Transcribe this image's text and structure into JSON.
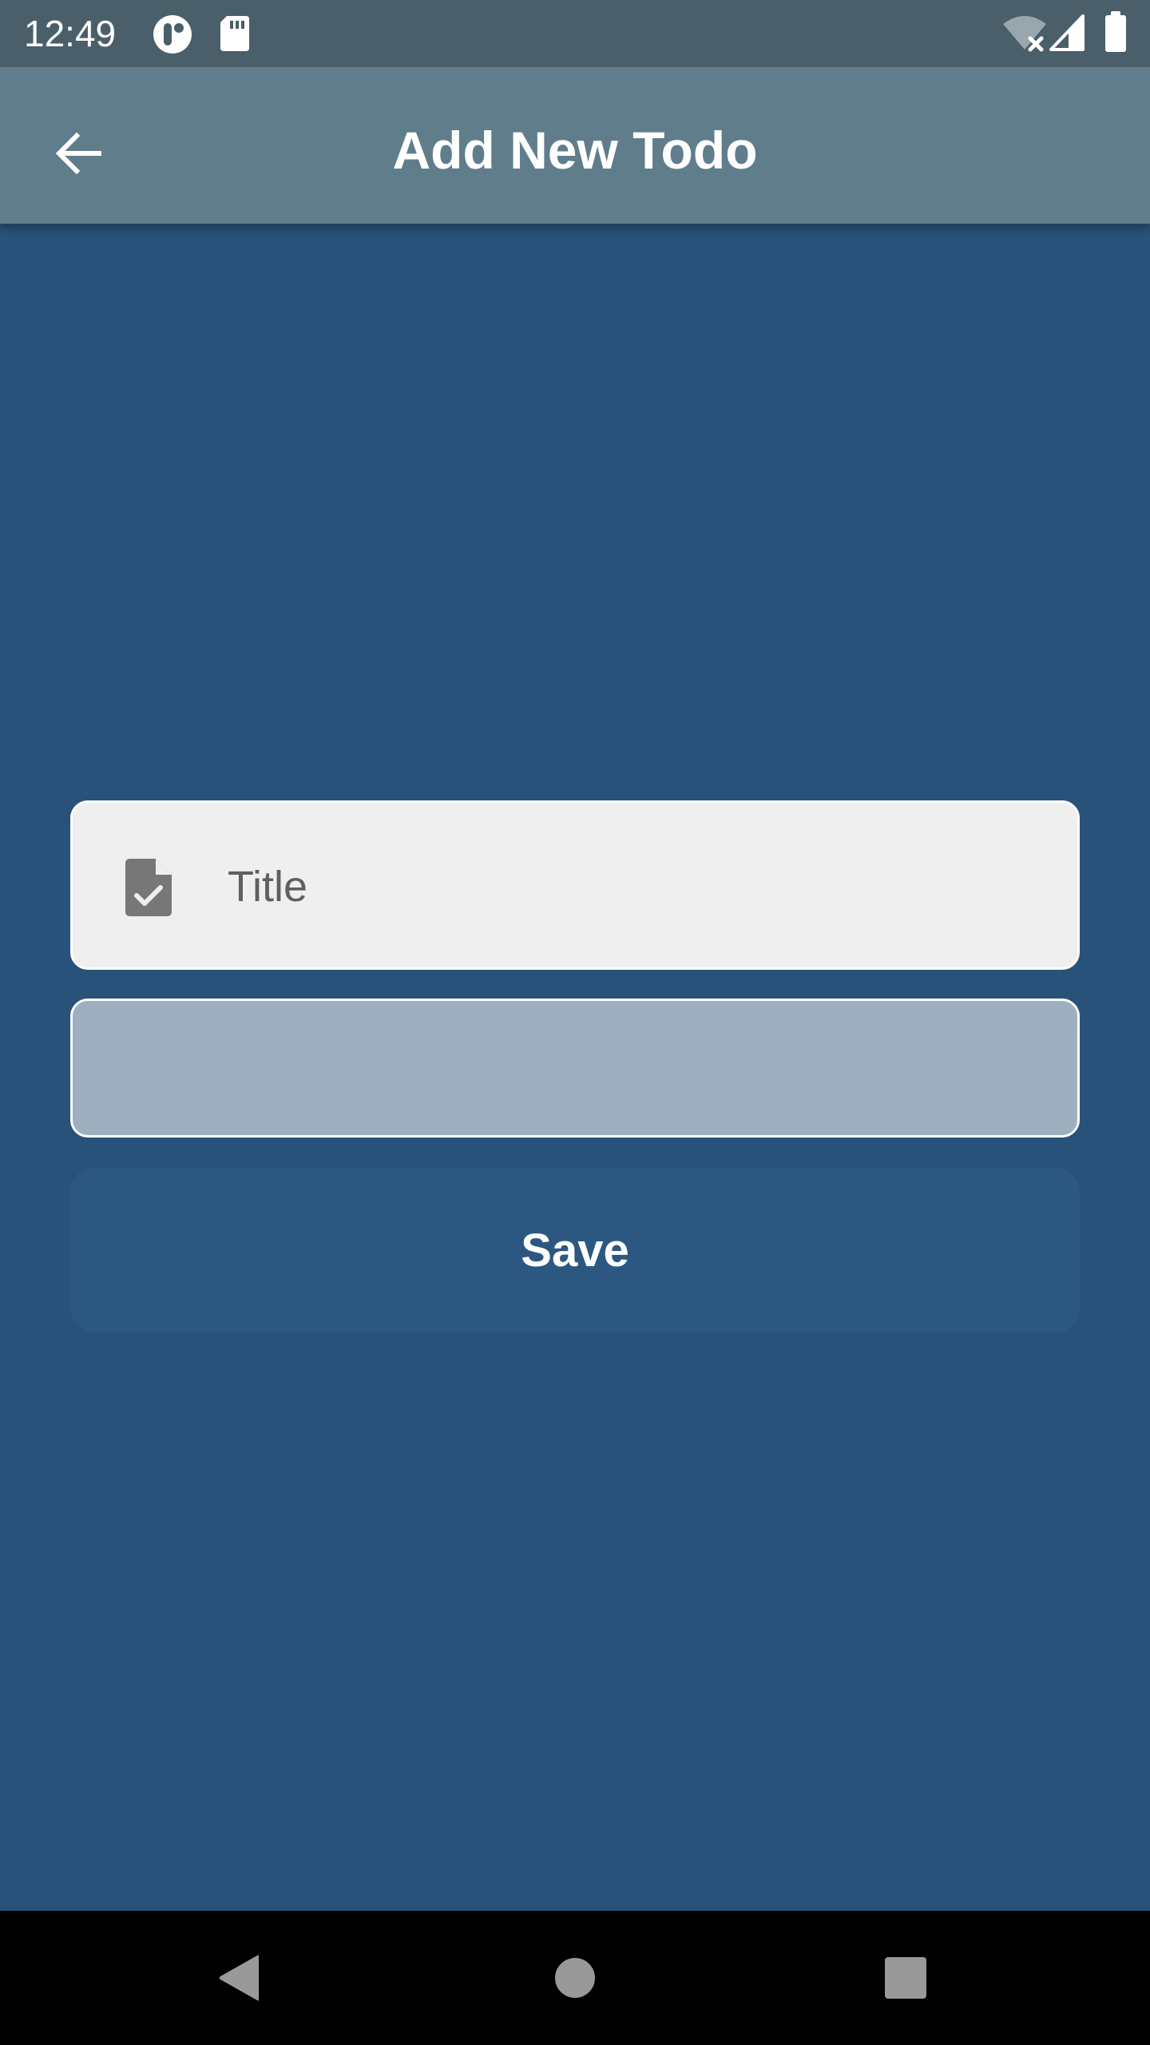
{
  "status_bar": {
    "time": "12:49",
    "icons": [
      "app-notification-icon",
      "sd-card-icon",
      "wifi-off-icon",
      "cellular-signal-icon",
      "battery-icon"
    ]
  },
  "app_bar": {
    "title": "Add New Todo",
    "back_icon": "arrow-back-icon"
  },
  "form": {
    "title_field": {
      "placeholder": "Title",
      "value": "",
      "icon": "task-document-icon"
    },
    "description_field": {
      "placeholder": "",
      "value": ""
    },
    "save_label": "Save"
  },
  "nav_bar": {
    "items": [
      "back-triangle-icon",
      "home-circle-icon",
      "recents-square-icon"
    ]
  },
  "colors": {
    "background": "#285279",
    "status_bar": "#4b5f6a",
    "app_bar": "#607d8b",
    "title_field": "#efefef",
    "description_field": "#9eafc0",
    "save_button": "#2c5781",
    "nav_bar": "#000000"
  }
}
